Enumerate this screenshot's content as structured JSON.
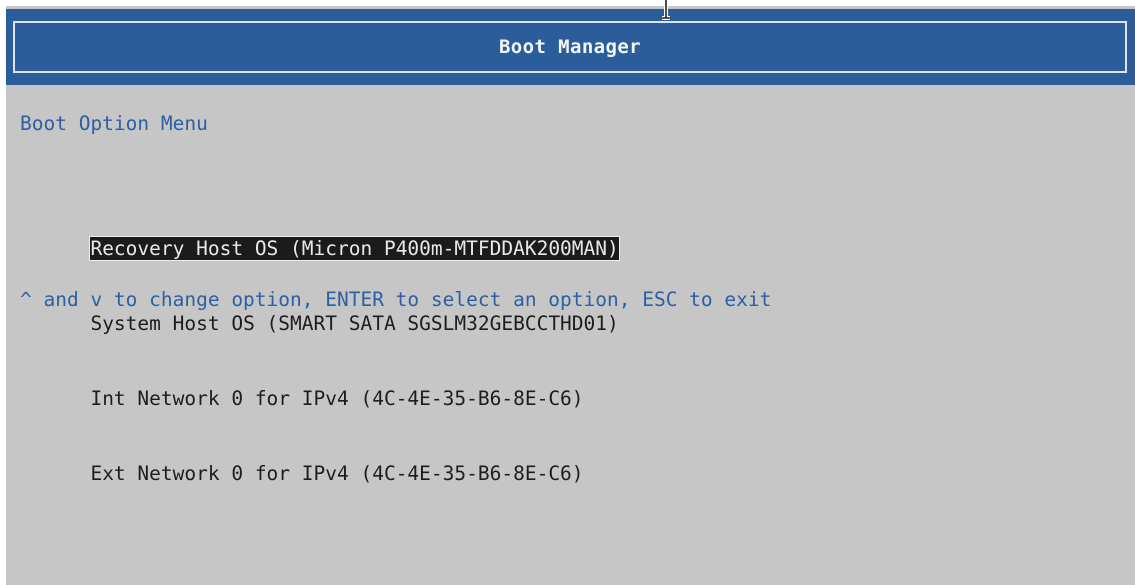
{
  "header": {
    "title": "Boot Manager"
  },
  "menu": {
    "title": "Boot Option Menu",
    "selected_index": 0,
    "options": [
      {
        "label": "Recovery Host OS (Micron P400m-MTFDDAK200MAN)"
      },
      {
        "label": "System Host OS (SMART SATA SGSLM32GEBCCTHD01)"
      },
      {
        "label": "Int Network 0 for IPv4 (4C-4E-35-B6-8E-C6)"
      },
      {
        "label": "Ext Network 0 for IPv4 (4C-4E-35-B6-8E-C6)"
      }
    ]
  },
  "hint": "^ and v to change option, ENTER to select an option, ESC to exit",
  "colors": {
    "header_bg": "#2b5d9b",
    "screen_bg": "#c6c6c6",
    "accent_text": "#2d5fa3",
    "selected_bg": "#1b1b1b"
  },
  "icons": {
    "mouse_cursor": "text-cursor-icon"
  }
}
